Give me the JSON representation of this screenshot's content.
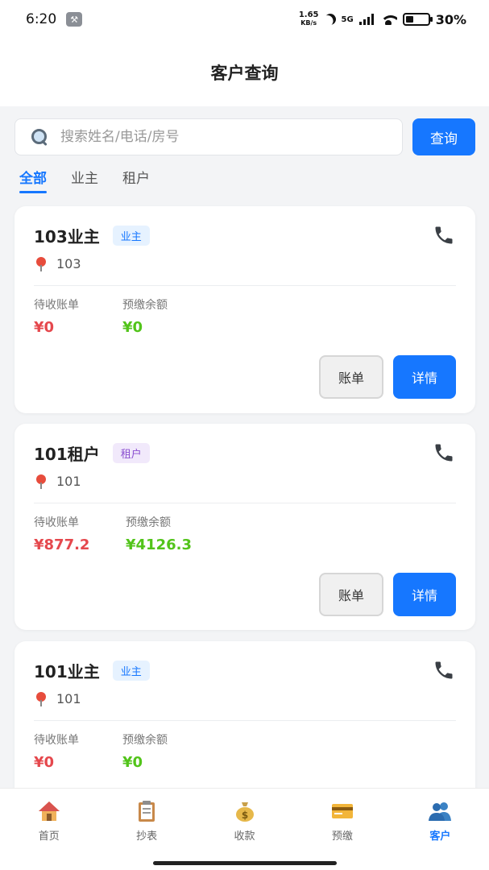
{
  "status_bar": {
    "time": "6:20",
    "net_speed_value": "1.65",
    "net_speed_unit": "KB/s",
    "network": "5G",
    "battery": "30%"
  },
  "header": {
    "title": "客户查询"
  },
  "search": {
    "placeholder": "搜索姓名/电话/房号",
    "value": "",
    "button_label": "查询"
  },
  "tabs": [
    {
      "label": "全部",
      "active": true
    },
    {
      "label": "业主",
      "active": false
    },
    {
      "label": "租户",
      "active": false
    }
  ],
  "customers": [
    {
      "name": "103业主",
      "type": "业主",
      "room": "103",
      "pending_label": "待收账单",
      "pending": "¥0",
      "prepaid_label": "预缴余额",
      "prepaid": "¥0",
      "bill_label": "账单",
      "detail_label": "详情"
    },
    {
      "name": "101租户",
      "type": "租户",
      "room": "101",
      "pending_label": "待收账单",
      "pending": "¥877.2",
      "prepaid_label": "预缴余额",
      "prepaid": "¥4126.3",
      "bill_label": "账单",
      "detail_label": "详情"
    },
    {
      "name": "101业主",
      "type": "业主",
      "room": "101",
      "pending_label": "待收账单",
      "pending": "¥0",
      "prepaid_label": "预缴余额",
      "prepaid": "¥0"
    }
  ],
  "bottom_nav": [
    {
      "label": "首页",
      "icon": "house-icon",
      "active": false
    },
    {
      "label": "抄表",
      "icon": "clipboard-icon",
      "active": false
    },
    {
      "label": "收款",
      "icon": "money-bag-icon",
      "active": false
    },
    {
      "label": "预缴",
      "icon": "credit-card-icon",
      "active": false
    },
    {
      "label": "客户",
      "icon": "users-icon",
      "active": true
    }
  ],
  "colors": {
    "accent": "#1677ff",
    "amount_red": "#e5484d",
    "amount_green": "#52c41a"
  }
}
